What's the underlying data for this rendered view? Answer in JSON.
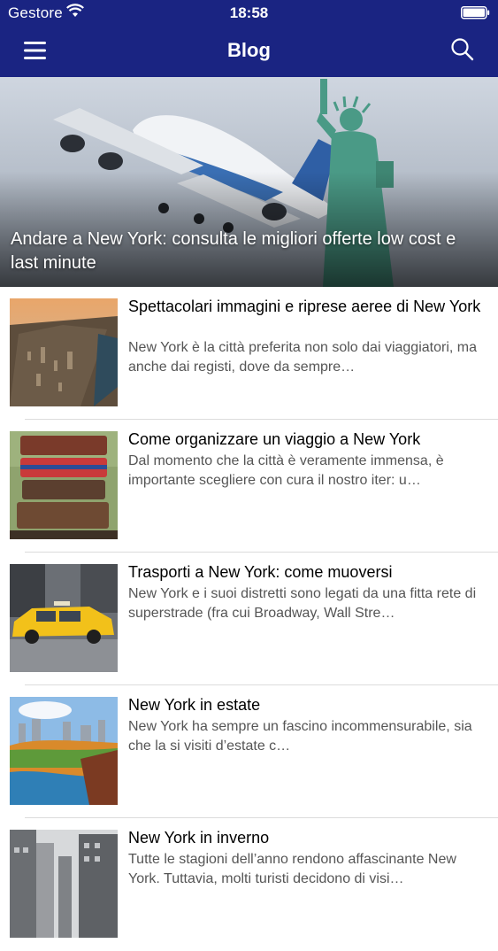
{
  "status_bar": {
    "carrier": "Gestore",
    "time": "18:58"
  },
  "nav": {
    "title": "Blog",
    "menu_icon": "hamburger-menu-icon",
    "search_icon": "search-icon"
  },
  "colors": {
    "nav_background": "#1a2482",
    "title_text": "#000000",
    "excerpt_text": "#555555"
  },
  "hero": {
    "title": "Andare a New York: consulta le migliori offerte low cost e last minute"
  },
  "articles": [
    {
      "title": "Spettacolari immagini e riprese aeree di New York",
      "excerpt": "New York è la città preferita non solo dai viaggiatori, ma anche dai registi, dove da sempre…"
    },
    {
      "title": "Come organizzare un viaggio a New York",
      "excerpt": "Dal momento che la città è veramente immensa, è importante scegliere con cura il nostro iter: u…"
    },
    {
      "title": "Trasporti a New York: come muoversi",
      "excerpt": "New York e i suoi distretti sono legati da una fitta rete di superstrade (fra cui Broadway, Wall Stre…"
    },
    {
      "title": "New York in estate",
      "excerpt": "New York ha sempre un fascino incommensurabile, sia che la si visiti d’estate c…"
    },
    {
      "title": "New York in inverno",
      "excerpt": "Tutte le stagioni dell’anno rendono affascinante New York. Tuttavia, molti turisti decidono di visi…"
    }
  ]
}
